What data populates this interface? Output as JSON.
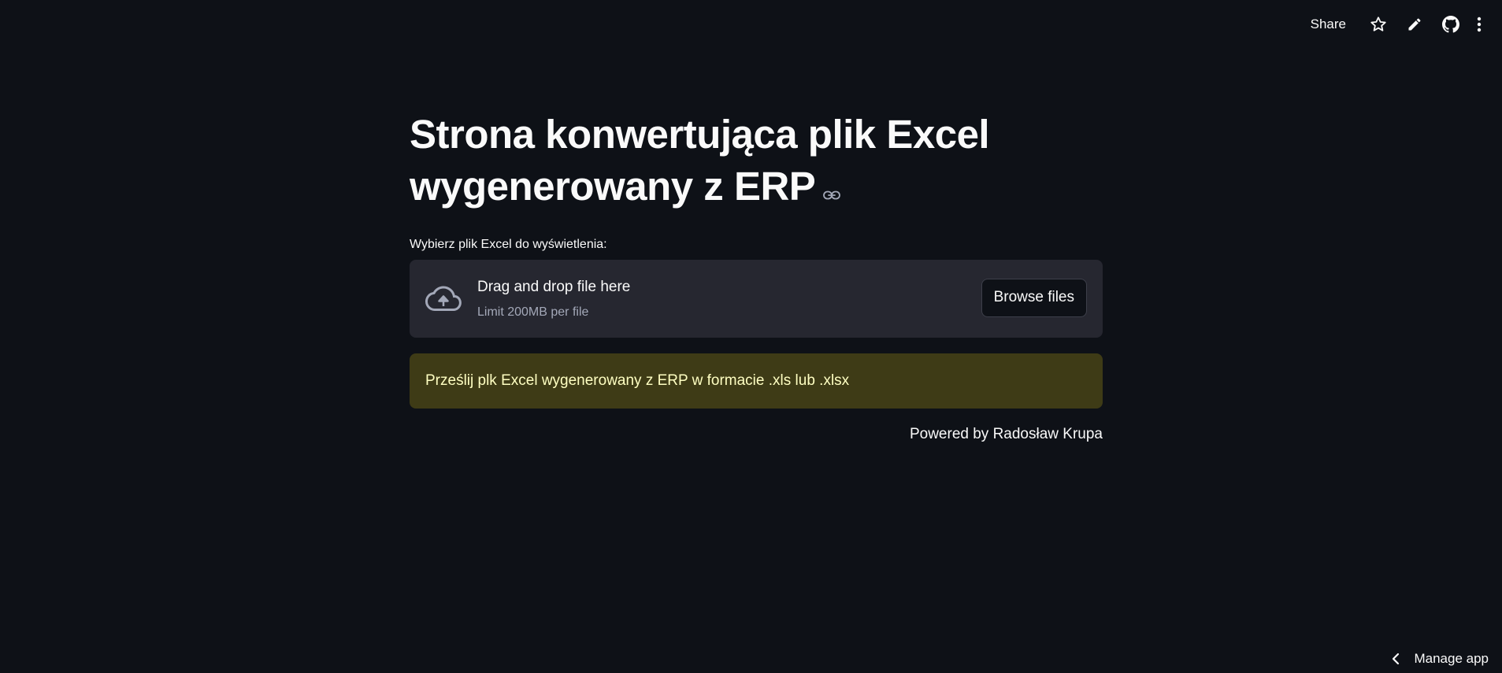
{
  "toolbar": {
    "share_label": "Share",
    "icons": [
      "star-icon",
      "pencil-icon",
      "github-icon",
      "more-vertical-icon"
    ]
  },
  "main": {
    "title": "Strona konwertująca plik Excel wygenerowany z ERP",
    "uploader": {
      "label": "Wybierz plik Excel do wyświetlenia:",
      "drop_text": "Drag and drop file here",
      "limit_text": "Limit 200MB per file",
      "browse_label": "Browse files"
    },
    "alert": {
      "text": "Prześlij plk Excel wygenerowany z ERP w formacie .xls lub .xlsx",
      "color": "#3e3b16",
      "text_color": "#ffffc2"
    },
    "footer_text": "Powered by Radosław Krupa"
  },
  "manage_app": {
    "label": "Manage app"
  },
  "colors": {
    "background": "#0e1117",
    "surface": "#262730",
    "text": "#fafafa"
  }
}
